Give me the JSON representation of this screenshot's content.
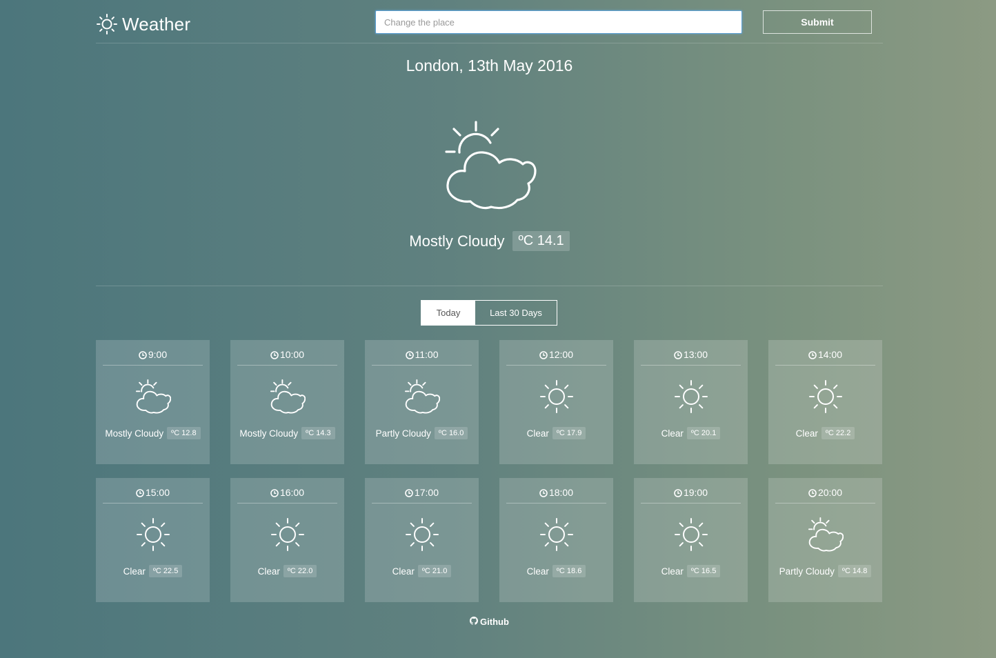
{
  "header": {
    "brand": "Weather",
    "brand_icon": "sun-icon",
    "search_placeholder": "Change the place",
    "search_value": "",
    "submit_label": "Submit"
  },
  "current": {
    "title": "London, 13th May 2016",
    "icon": "partly-cloudy-icon",
    "condition": "Mostly Cloudy",
    "temperature": "ºC 14.1"
  },
  "tabs": [
    {
      "label": "Today",
      "active": true
    },
    {
      "label": "Last 30 Days",
      "active": false
    }
  ],
  "hourly": [
    {
      "time": "9:00",
      "icon": "partly-cloudy-icon",
      "condition": "Mostly Cloudy",
      "temperature": "ºC 12.8"
    },
    {
      "time": "10:00",
      "icon": "partly-cloudy-icon",
      "condition": "Mostly Cloudy",
      "temperature": "ºC 14.3"
    },
    {
      "time": "11:00",
      "icon": "partly-cloudy-icon",
      "condition": "Partly Cloudy",
      "temperature": "ºC 16.0"
    },
    {
      "time": "12:00",
      "icon": "sun-icon",
      "condition": "Clear",
      "temperature": "ºC 17.9"
    },
    {
      "time": "13:00",
      "icon": "sun-icon",
      "condition": "Clear",
      "temperature": "ºC 20.1"
    },
    {
      "time": "14:00",
      "icon": "sun-icon",
      "condition": "Clear",
      "temperature": "ºC 22.2"
    },
    {
      "time": "15:00",
      "icon": "sun-icon",
      "condition": "Clear",
      "temperature": "ºC 22.5"
    },
    {
      "time": "16:00",
      "icon": "sun-icon",
      "condition": "Clear",
      "temperature": "ºC 22.0"
    },
    {
      "time": "17:00",
      "icon": "sun-icon",
      "condition": "Clear",
      "temperature": "ºC 21.0"
    },
    {
      "time": "18:00",
      "icon": "sun-icon",
      "condition": "Clear",
      "temperature": "ºC 18.6"
    },
    {
      "time": "19:00",
      "icon": "sun-icon",
      "condition": "Clear",
      "temperature": "ºC 16.5"
    },
    {
      "time": "20:00",
      "icon": "partly-cloudy-icon",
      "condition": "Partly Cloudy",
      "temperature": "ºC 14.8"
    }
  ],
  "footer": {
    "link_label": "Github",
    "link_icon": "github-icon"
  },
  "colors": {
    "background_left": "#4c767c",
    "background_right": "#8c9a83",
    "text": "#ffffff",
    "input_focus_border": "#5a9fd4"
  }
}
